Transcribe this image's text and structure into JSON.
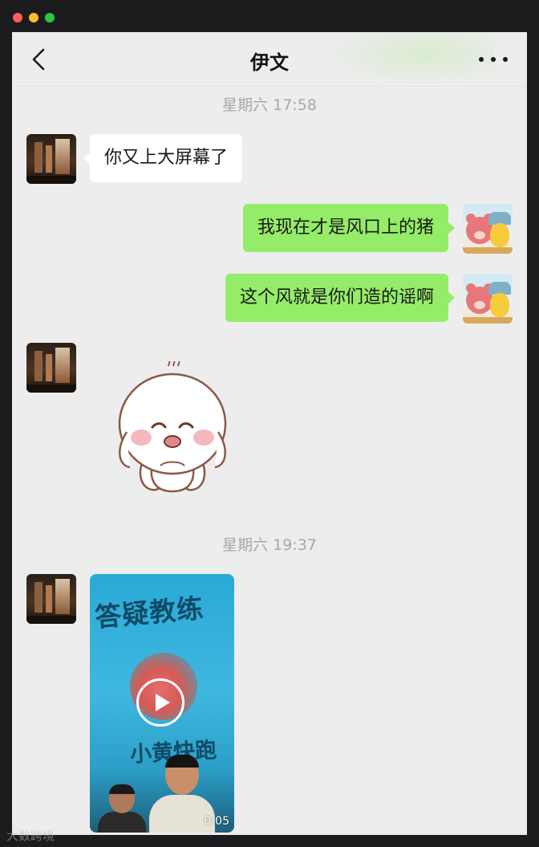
{
  "window": {
    "controls": [
      "close",
      "minimize",
      "zoom"
    ]
  },
  "header": {
    "title": "伊文"
  },
  "messages": {
    "time1": "星期六 17:58",
    "m1": "你又上大屏幕了",
    "m2": "我现在才是风口上的猪",
    "m3": "这个风就是你们造的谣啊",
    "time2": "星期六 19:37"
  },
  "video": {
    "title": "答疑教练",
    "subtitle": "小黄快跑",
    "duration": "0:05"
  },
  "watermark": "大数跨境",
  "colors": {
    "outgoing_bubble": "#95ec69",
    "incoming_bubble": "#ffffff",
    "chat_background": "#ededed"
  },
  "icons": [
    "back-chevron-icon",
    "more-dots-icon",
    "play-icon"
  ]
}
